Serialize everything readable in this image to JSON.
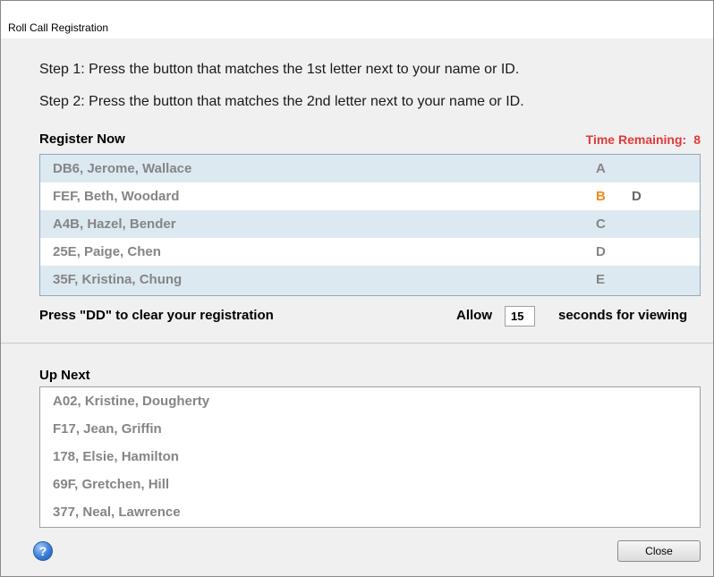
{
  "window": {
    "title": "Roll Call Registration"
  },
  "instructions": {
    "step1": "Step 1: Press the button that matches the 1st letter next to your name or ID.",
    "step2": "Step 2: Press the button that matches the 2nd letter next to your name or ID."
  },
  "register": {
    "label": "Register Now",
    "time_label": "Time Remaining:",
    "time_value": "8",
    "rows": [
      {
        "name": "DB6, Jerome, Wallace",
        "letter1": "A",
        "letter2": ""
      },
      {
        "name": "FEF, Beth, Woodard",
        "letter1": "B",
        "letter2": "D",
        "active": true
      },
      {
        "name": "A4B, Hazel, Bender",
        "letter1": "C",
        "letter2": ""
      },
      {
        "name": "25E, Paige, Chen",
        "letter1": "D",
        "letter2": ""
      },
      {
        "name": "35F, Kristina, Chung",
        "letter1": "E",
        "letter2": ""
      }
    ]
  },
  "footer_controls": {
    "clear_text": "Press \"DD\" to clear your registration",
    "allow_label": "Allow",
    "allow_value": "15",
    "viewing_label": "seconds for viewing"
  },
  "up_next": {
    "label": "Up Next",
    "items": [
      "A02, Kristine, Dougherty",
      "F17, Jean, Griffin",
      "178, Elsie, Hamilton",
      "69F, Gretchen, Hill",
      "377, Neal, Lawrence"
    ]
  },
  "actions": {
    "help_icon": "?",
    "close_label": "Close"
  },
  "colors": {
    "accent_active": "#f28a1e",
    "time_remaining": "#e03a3a",
    "row_shade": "#dde9f1"
  }
}
